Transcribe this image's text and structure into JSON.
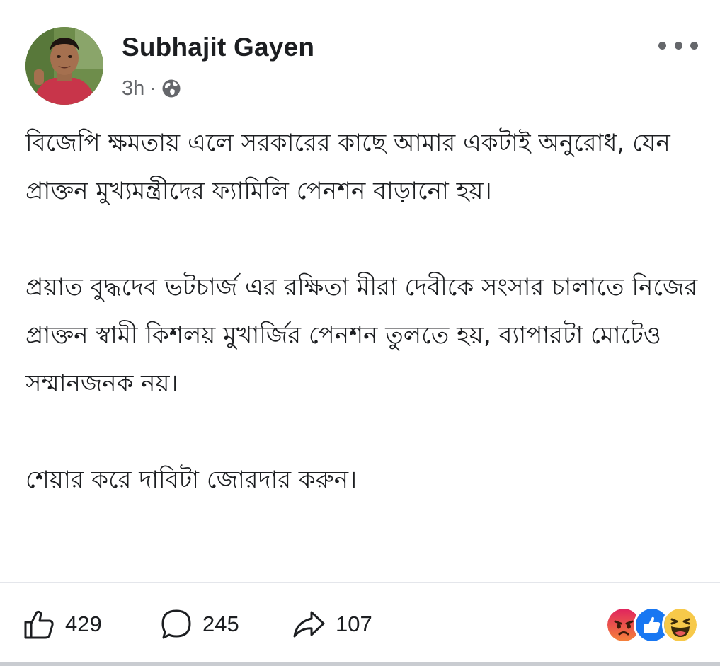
{
  "author": {
    "name": "Subhajit Gayen",
    "time": "3h",
    "separator": "·",
    "audience_icon": "globe-icon"
  },
  "header": {
    "more_icon": "more-dots-icon"
  },
  "post": {
    "paragraphs": [
      "বিজেপি ক্ষমতায় এলে সরকারের কাছে আমার একটাই অনুরোধ, যেন প্রাক্তন মুখ্যমন্ত্রীদের ফ্যামিলি পেনশন বাড়ানো হয়।",
      "প্রয়াত বুদ্ধদেব ভটচার্জ এর রক্ষিতা মীরা দেবীকে সংসার চালাতে নিজের প্রাক্তন স্বামী কিশলয় মুখার্জির পেনশন তুলতে হয়, ব্যাপারটা মোটেও সম্মানজনক নয়।",
      "শেয়ার করে দাবিটা জোরদার করুন।"
    ]
  },
  "footer": {
    "likes": "429",
    "comments": "245",
    "shares": "107",
    "like_icon": "thumbs-up-icon",
    "comment_icon": "comment-bubble-icon",
    "share_icon": "share-arrow-icon",
    "reactions": [
      "angry-reaction-icon",
      "like-reaction-icon",
      "haha-reaction-icon"
    ]
  },
  "colors": {
    "text": "#1c1e21",
    "secondary": "#65676b",
    "like_blue": "#1877f2",
    "angry_start": "#f5823b",
    "angry_end": "#e0245e",
    "haha_yellow": "#f7c94a"
  }
}
